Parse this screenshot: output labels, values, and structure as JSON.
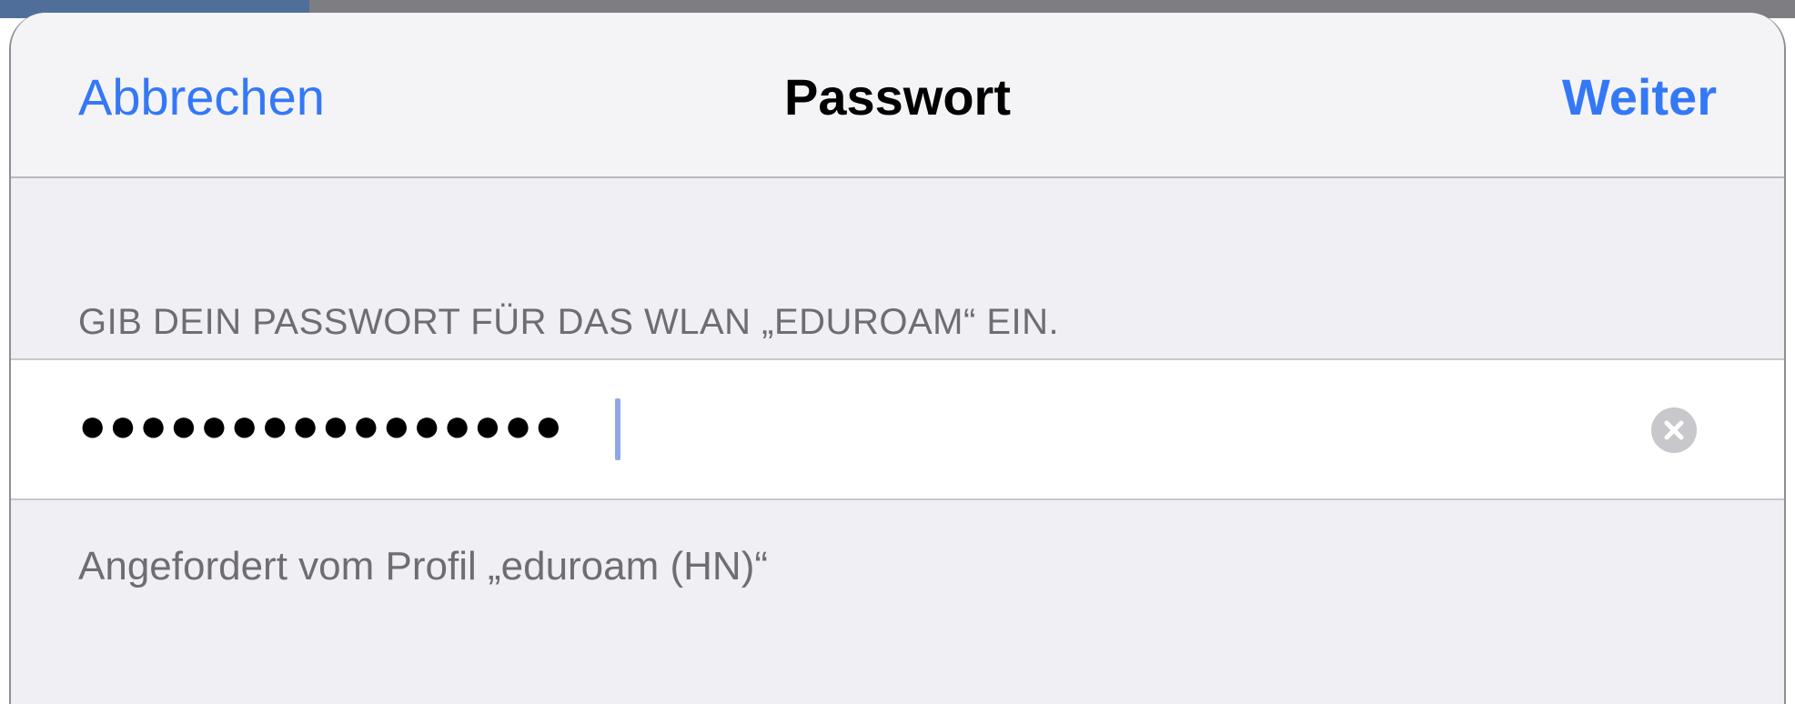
{
  "nav": {
    "cancel_label": "Abbrechen",
    "title": "Passwort",
    "next_label": "Weiter"
  },
  "form": {
    "section_header": "GIB DEIN PASSWORT FÜR DAS WLAN „EDUROAM“ EIN.",
    "password_masked": "●●●●●●●●●●●●●●●●",
    "clear_icon": "clear-circle-icon",
    "footer": "Angefordert vom Profil „eduroam (HN)“"
  },
  "colors": {
    "accent": "#3478f6",
    "sheet_background": "#efeff4",
    "secondary_text": "#6d6d72"
  }
}
